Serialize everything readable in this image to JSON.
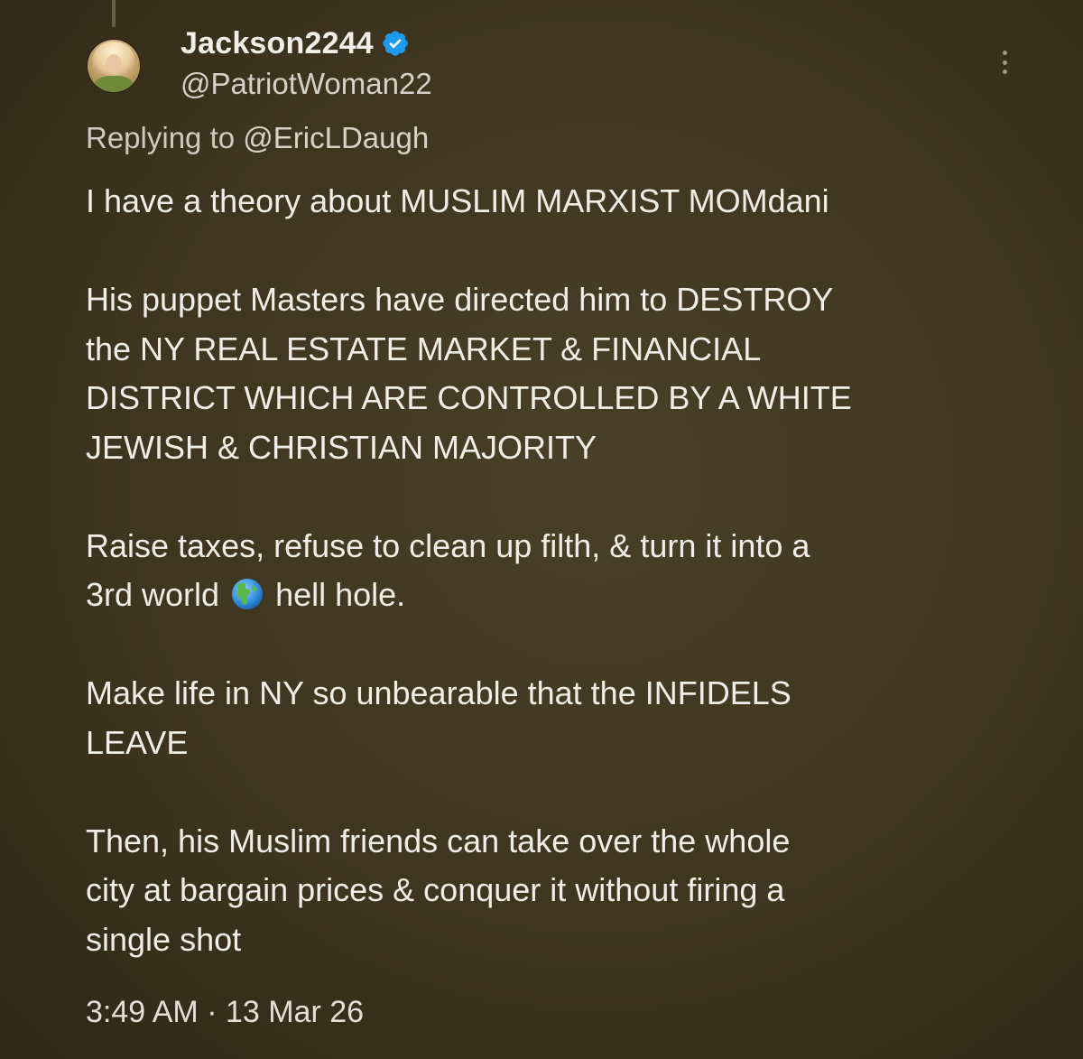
{
  "user": {
    "display_name": "Jackson2244",
    "handle": "@PatriotWoman22",
    "verified": true
  },
  "reply": {
    "prefix": "Replying to ",
    "mention": "@EricLDaugh"
  },
  "tweet": {
    "paragraphs": [
      "I have a theory about MUSLIM MARXIST MOMdani",
      "His puppet Masters have directed him to DESTROY\nthe NY REAL ESTATE MARKET & FINANCIAL\nDISTRICT WHICH ARE CONTROLLED BY A WHITE\nJEWISH & CHRISTIAN MAJORITY",
      "Make life in NY so unbearable that the INFIDELS\nLEAVE",
      "Then, his Muslim friends can take over the whole\ncity at bargain prices & conquer it without firing a\nsingle shot"
    ],
    "taxes_line_1": "Raise taxes, refuse to clean up filth, & turn it into a",
    "taxes_line_2_before": "3rd world ",
    "taxes_line_2_after": " hell hole."
  },
  "timestamp": "3:49 AM · 13 Mar 26",
  "icons": {
    "verified": "verified-badge-icon",
    "more": "more-options-icon",
    "globe": "globe-americas-emoji"
  },
  "colors": {
    "background": "#3f3520",
    "verified_blue": "#1d9bf0"
  }
}
